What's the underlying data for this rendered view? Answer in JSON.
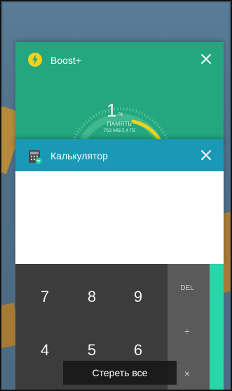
{
  "recents": {
    "cards": [
      {
        "title": "Boost+",
        "icon": "boost-lightning-icon",
        "gauge": {
          "value": "1",
          "unit": "%",
          "label": "ПАМЯТЬ",
          "sub": "753 МБ/2,4 ГБ"
        }
      },
      {
        "title": "Калькулятор",
        "icon": "calculator-icon"
      }
    ],
    "keypad": {
      "digits": [
        "7",
        "8",
        "9",
        "4",
        "5",
        "6"
      ],
      "ops": [
        "DEL",
        "÷",
        "×"
      ]
    },
    "clear_all_label": "Стереть все"
  },
  "colors": {
    "boost_header": "#24a77f",
    "calculator_header": "#1a98b6",
    "gauge_arc": "#f2d31a",
    "accent": "#27d7a8"
  }
}
